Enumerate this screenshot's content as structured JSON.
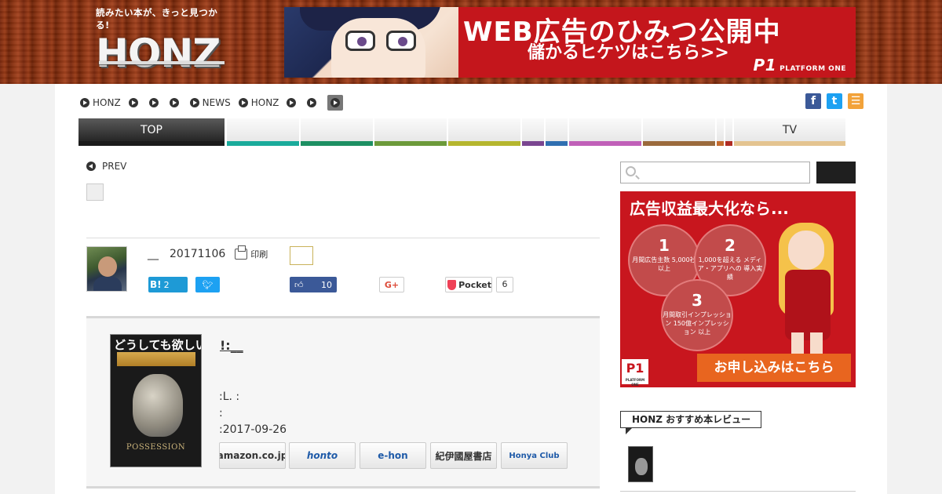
{
  "header": {
    "logo_tagline": "読みたい本が、きっと見つかる!",
    "logo_text": "HONZ",
    "banner": {
      "headline": "WEB広告のひみつ公開中",
      "subline": "儲かるヒケツはこちら>>",
      "brand": "PLATFORM ONE",
      "brand_mark": "P1"
    }
  },
  "breadcrumb": {
    "items": [
      "HONZ",
      "",
      "",
      "",
      "NEWS",
      "HONZ",
      "",
      ""
    ]
  },
  "social_icons": [
    "facebook-icon",
    "twitter-icon",
    "rss-icon"
  ],
  "nav": {
    "tabs": [
      {
        "label": "TOP",
        "bar": "#1b1b1b"
      },
      {
        "label": "",
        "bar": "#1aab9b"
      },
      {
        "label": "",
        "bar": "#1d8f62"
      },
      {
        "label": "",
        "bar": "#6c9a3a"
      },
      {
        "label": "",
        "bar": "#b5b62e"
      },
      {
        "label": "",
        "bar": "#7a4690"
      },
      {
        "label": "",
        "bar": "#2f6fb1"
      },
      {
        "label": "",
        "bar": "#c060b8"
      },
      {
        "label": "",
        "bar": "#9b6a3c"
      },
      {
        "label": "",
        "bar": "#c46a2d"
      },
      {
        "label": "",
        "bar": "#b02b23"
      },
      {
        "label": "TV",
        "bar": "#e4c490"
      }
    ]
  },
  "article": {
    "prev_label": "PREV",
    "author_sep": "__",
    "date": "20171106",
    "print_label": "印刷",
    "share": {
      "hatena_label": "B!",
      "hatena_count": "2",
      "fb_count": "10",
      "gplus_label": "G+",
      "pocket_label": "Pocket",
      "pocket_count": "6"
    }
  },
  "book": {
    "cover_title": "どうしても欲しい!",
    "cover_word": "POSSESSION",
    "title": "!:__",
    "line1": ":L. :",
    "line2": ":",
    "line3": ":2017-09-26",
    "shops": [
      {
        "label": "amazon.co.jp",
        "color": "#222"
      },
      {
        "label": "honto",
        "color": "#1e5aa8"
      },
      {
        "label": "e-hon",
        "color": "#1e5aa8"
      },
      {
        "label": "紀伊國屋書店",
        "color": "#222"
      },
      {
        "label": "Honya Club",
        "color": "#1e5aa8"
      }
    ]
  },
  "sidebar": {
    "search_placeholder": "",
    "ad": {
      "title": "広告収益最大化なら...",
      "circles": [
        {
          "num": "1",
          "text": "月間広告主数 5,000社以上"
        },
        {
          "num": "2",
          "text": "1,000を超える メディア・アプリへの 導入実績"
        },
        {
          "num": "3",
          "text": "月間取引インプレッション 150億インプレッション 以上"
        }
      ],
      "cta": "お申し込みはこちら",
      "logo": "P1",
      "logo_sub": "PLATFORM ONE"
    },
    "recommend_label": "HONZ おすすめ本レビュー"
  }
}
